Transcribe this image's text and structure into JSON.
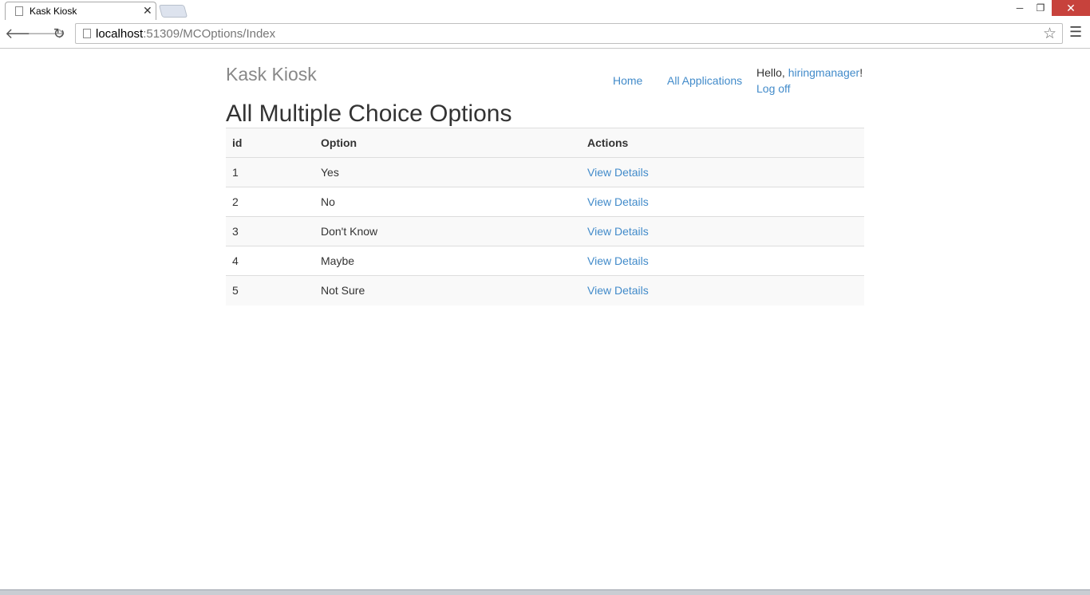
{
  "browser": {
    "tab_title": "Kask Kiosk",
    "tab_close": "✕",
    "url_host": "localhost",
    "url_path": ":51309/MCOptions/Index"
  },
  "header": {
    "brand": "Kask Kiosk",
    "nav": {
      "home": "Home",
      "all_applications": "All Applications"
    },
    "greeting_prefix": "Hello, ",
    "username": "hiringmanager",
    "greeting_suffix": "!",
    "logoff": "Log off"
  },
  "main": {
    "title": "All Multiple Choice Options",
    "table": {
      "headers": {
        "id": "id",
        "option": "Option",
        "actions": "Actions"
      },
      "rows": [
        {
          "id": "1",
          "option": "Yes",
          "action": "View Details"
        },
        {
          "id": "2",
          "option": "No",
          "action": "View Details"
        },
        {
          "id": "3",
          "option": "Don't Know",
          "action": "View Details"
        },
        {
          "id": "4",
          "option": "Maybe",
          "action": "View Details"
        },
        {
          "id": "5",
          "option": "Not Sure",
          "action": "View Details"
        }
      ]
    }
  },
  "icons": {
    "back": "back-arrow-icon",
    "forward": "forward-arrow-icon",
    "reload": "reload-icon",
    "star": "star-icon",
    "menu": "hamburger-menu-icon"
  }
}
